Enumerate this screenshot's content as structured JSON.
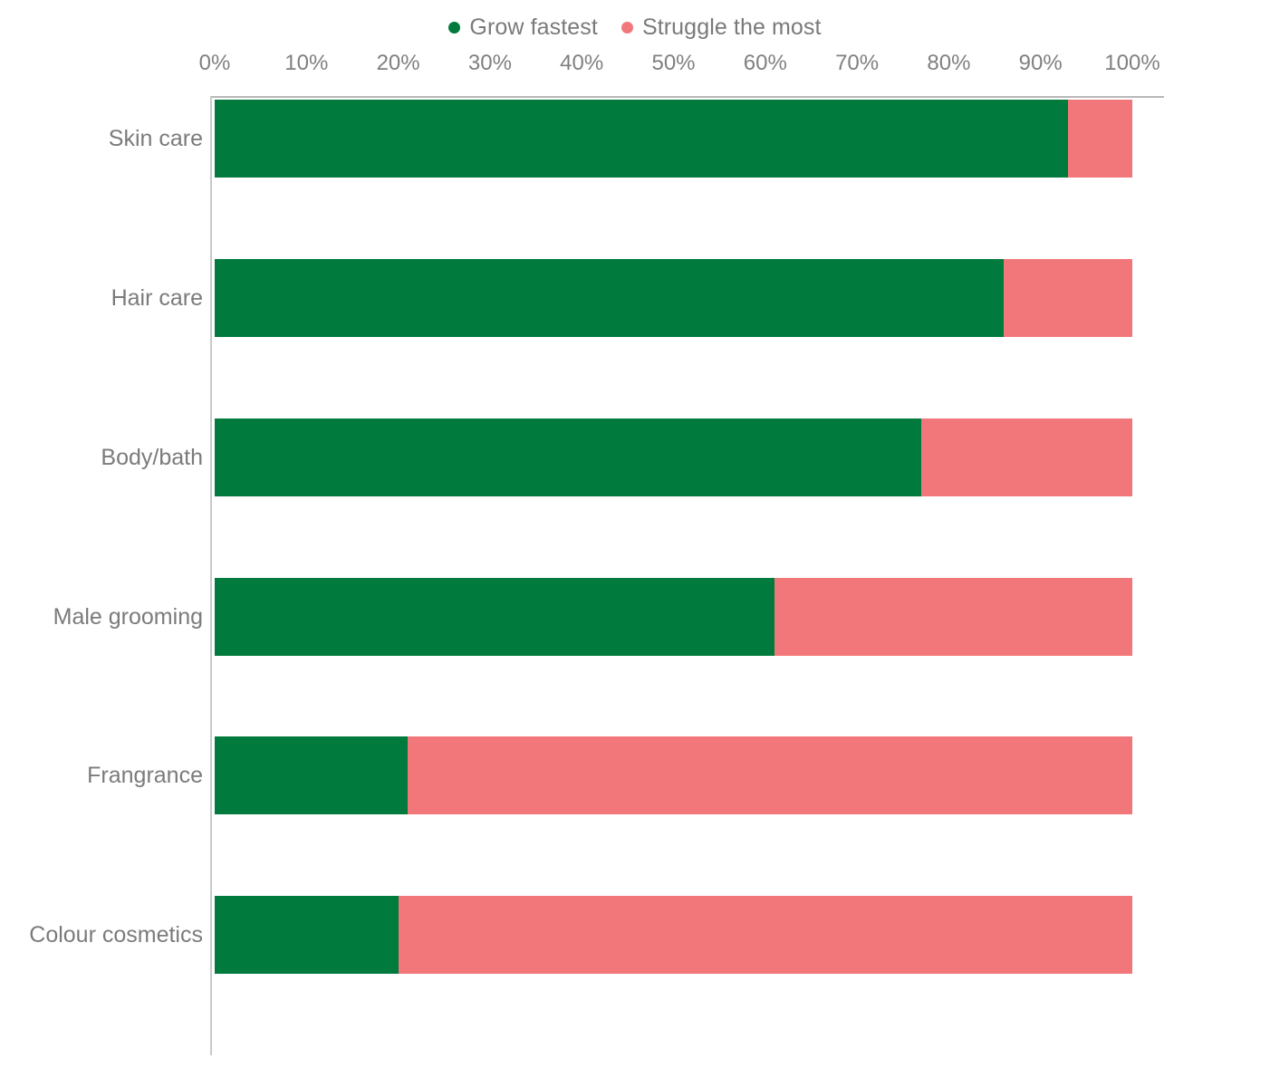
{
  "legend": {
    "items": [
      {
        "label": "Grow fastest",
        "color": "#007a3d",
        "icon": "dot-icon"
      },
      {
        "label": "Struggle the most",
        "color": "#f2777a",
        "icon": "dot-icon"
      }
    ]
  },
  "axis": {
    "ticks": [
      "0%",
      "10%",
      "20%",
      "30%",
      "40%",
      "50%",
      "60%",
      "70%",
      "80%",
      "90%",
      "100%"
    ]
  },
  "categories": [
    "Skin care",
    "Hair care",
    "Body/bath",
    "Male grooming",
    "Frangrance",
    "Colour cosmetics"
  ],
  "chart_data": {
    "type": "bar",
    "orientation": "horizontal",
    "stacked": true,
    "normalized_percent": true,
    "title": "",
    "subtitle": "",
    "xlabel": "",
    "ylabel": "",
    "xlim": [
      0,
      100
    ],
    "xticks": [
      0,
      10,
      20,
      30,
      40,
      50,
      60,
      70,
      80,
      90,
      100
    ],
    "xtick_labels": [
      "0%",
      "10%",
      "20%",
      "30%",
      "40%",
      "50%",
      "60%",
      "70%",
      "80%",
      "90%",
      "100%"
    ],
    "grid": false,
    "legend_position": "top-center",
    "categories": [
      "Skin care",
      "Hair care",
      "Body/bath",
      "Male grooming",
      "Frangrance",
      "Colour cosmetics"
    ],
    "series": [
      {
        "name": "Grow fastest",
        "color": "#007a3d",
        "values": [
          93,
          86,
          77,
          61,
          21,
          20
        ]
      },
      {
        "name": "Struggle the most",
        "color": "#f2777a",
        "values": [
          7,
          14,
          23,
          39,
          79,
          80
        ]
      }
    ]
  }
}
